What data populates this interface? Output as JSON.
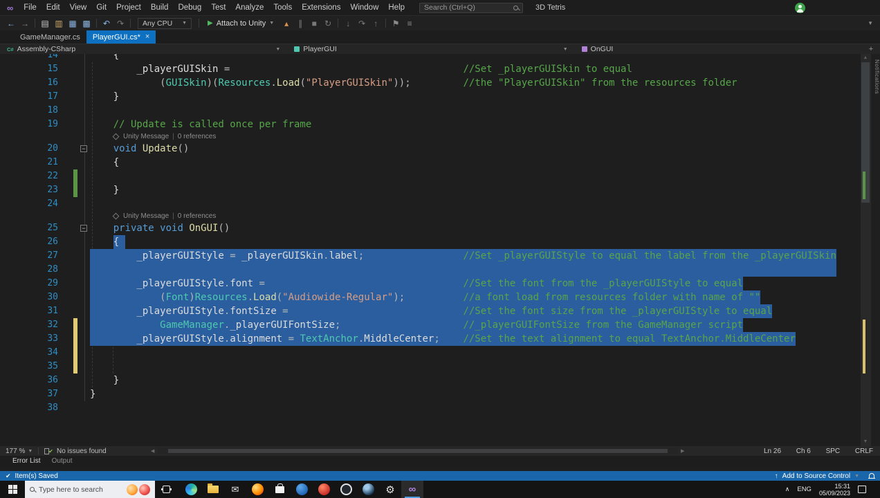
{
  "window": {
    "project": "3D Tetris",
    "search": "Search (Ctrl+Q)"
  },
  "menus": [
    "File",
    "Edit",
    "View",
    "Git",
    "Project",
    "Build",
    "Debug",
    "Test",
    "Analyze",
    "Tools",
    "Extensions",
    "Window",
    "Help"
  ],
  "toolbar": {
    "config_label": "Any CPU",
    "run_label": "Attach to Unity",
    "items_left": [
      {
        "n": "back-arrow",
        "g": "←",
        "c": "#8ab4e0"
      },
      {
        "n": "forward-arrow",
        "g": "→",
        "c": "#8a8a8a"
      },
      {
        "sep": true
      },
      {
        "n": "new-file-icon",
        "g": "▤",
        "c": "#c8c8c8"
      },
      {
        "n": "open-file-icon",
        "g": "▥",
        "c": "#c8a96a"
      },
      {
        "n": "save-icon",
        "g": "▦",
        "c": "#8ab4e0"
      },
      {
        "n": "save-all-icon",
        "g": "▩",
        "c": "#8ab4e0"
      },
      {
        "sep": true
      },
      {
        "n": "undo-icon",
        "g": "↶",
        "c": "#8ab4e0"
      },
      {
        "n": "redo-icon",
        "g": "↷",
        "c": "#7a7a7a"
      },
      {
        "sep": true
      }
    ],
    "items_right": [
      {
        "n": "hot-reload-icon",
        "g": "▴",
        "c": "#d9914f"
      },
      {
        "n": "pause-icon",
        "g": "∥",
        "c": "#7a7a7a"
      },
      {
        "n": "stop-icon",
        "g": "■",
        "c": "#7a7a7a"
      },
      {
        "n": "restart-icon",
        "g": "↻",
        "c": "#7a7a7a"
      },
      {
        "sep": true
      },
      {
        "n": "step-into-icon",
        "g": "↓",
        "c": "#7a7a7a"
      },
      {
        "n": "step-over-icon",
        "g": "↷",
        "c": "#7a7a7a"
      },
      {
        "n": "step-out-icon",
        "g": "↑",
        "c": "#7a7a7a"
      },
      {
        "sep": true
      },
      {
        "n": "bookmark-icon",
        "g": "⚑",
        "c": "#8a8a8a"
      },
      {
        "n": "outline-icon",
        "g": "≡",
        "c": "#8a8a8a"
      }
    ]
  },
  "tabs": [
    {
      "label": "GameManager.cs",
      "active": false
    },
    {
      "label": "PlayerGUI.cs*",
      "active": true
    }
  ],
  "breadcrumb": [
    "Assembly-CSharp",
    "PlayerGUI",
    "OnGUI"
  ],
  "side_strip": {
    "label": "Notifications"
  },
  "editor": {
    "rows": [
      {
        "n": 14,
        "tok": [
          [
            "p",
            "    {"
          ]
        ]
      },
      {
        "n": 15,
        "tok": [
          [
            "p",
            "        _playerGUISkin "
          ],
          [
            "o",
            "="
          ]
        ],
        "cmt": "//Set _playerGUISkin to equal"
      },
      {
        "n": 16,
        "tok": [
          [
            "o",
            "            ("
          ],
          [
            "t",
            "GUISkin"
          ],
          [
            "o",
            ")("
          ],
          [
            "t",
            "Resources"
          ],
          [
            "o",
            "."
          ],
          [
            "m",
            "Load"
          ],
          [
            "o",
            "("
          ],
          [
            "s",
            "\"PlayerGUISkin\""
          ],
          [
            "o",
            "));"
          ]
        ],
        "cmt": "//the \"PlayerGUISkin\" from the resources folder"
      },
      {
        "n": 17,
        "tok": [
          [
            "p",
            "    }"
          ]
        ]
      },
      {
        "n": 18
      },
      {
        "n": 19,
        "tok": [
          [
            "c",
            "    // Update is called once per frame"
          ]
        ]
      },
      {
        "lens": true,
        "a": "Unity Message",
        "b": "0 references"
      },
      {
        "n": 20,
        "fold": true,
        "tok": [
          [
            "k",
            "    void"
          ],
          [
            "p",
            " "
          ],
          [
            "m",
            "Update"
          ],
          [
            "o",
            "()"
          ]
        ]
      },
      {
        "n": 21,
        "tok": [
          [
            "p",
            "    {"
          ]
        ]
      },
      {
        "n": 22
      },
      {
        "n": 23,
        "tok": [
          [
            "p",
            "    }"
          ]
        ]
      },
      {
        "n": 24
      },
      {
        "lens": true,
        "a": "Unity Message",
        "b": "0 references"
      },
      {
        "n": 25,
        "fold": true,
        "tok": [
          [
            "k",
            "    private"
          ],
          [
            "p",
            " "
          ],
          [
            "k",
            "void"
          ],
          [
            "p",
            " "
          ],
          [
            "m",
            "OnGUI"
          ],
          [
            "o",
            "()"
          ]
        ]
      },
      {
        "n": 26,
        "sel": [
          4,
          2
        ],
        "tok": [
          [
            "p",
            "    {"
          ]
        ]
      },
      {
        "n": 27,
        "sel": [
          0,
          128
        ],
        "tok": [
          [
            "p",
            "        _playerGUIStyle "
          ],
          [
            "o",
            "= "
          ],
          [
            "p",
            "_playerGUISkin"
          ],
          [
            "o",
            "."
          ],
          [
            "p",
            "label"
          ],
          [
            "o",
            ";"
          ]
        ],
        "cmt": "//Set _playerGUIStyle to equal the label from the _playerGUISkin"
      },
      {
        "n": 28,
        "sel": [
          0,
          128
        ]
      },
      {
        "n": 29,
        "sel": [
          0,
          112
        ],
        "tok": [
          [
            "p",
            "        _playerGUIStyle"
          ],
          [
            "o",
            "."
          ],
          [
            "p",
            "font "
          ],
          [
            "o",
            "="
          ]
        ],
        "cmt": "//Set the font from the _playerGUIStyle to equal"
      },
      {
        "n": 30,
        "sel": [
          0,
          115
        ],
        "tok": [
          [
            "o",
            "            ("
          ],
          [
            "t",
            "Font"
          ],
          [
            "o",
            ")"
          ],
          [
            "t",
            "Resources"
          ],
          [
            "o",
            "."
          ],
          [
            "m",
            "Load"
          ],
          [
            "o",
            "("
          ],
          [
            "s",
            "\"Audiowide-Regular\""
          ],
          [
            "o",
            ");"
          ]
        ],
        "cmt": "//a font load from resources folder with name of \"\""
      },
      {
        "n": 31,
        "sel": [
          0,
          117
        ],
        "tok": [
          [
            "p",
            "        _playerGUIStyle"
          ],
          [
            "o",
            "."
          ],
          [
            "p",
            "fontSize "
          ],
          [
            "o",
            "="
          ]
        ],
        "cmt": "//Set the font size from the _playerGUIStyle to equal"
      },
      {
        "n": 32,
        "sel": [
          0,
          112
        ],
        "tok": [
          [
            "p",
            "            "
          ],
          [
            "t",
            "GameManager"
          ],
          [
            "o",
            "."
          ],
          [
            "p",
            "_playerGUIFontSize"
          ],
          [
            "o",
            ";"
          ]
        ],
        "cmt": "//_playerGUIFontSize from the GameManager script"
      },
      {
        "n": 33,
        "sel": [
          0,
          121
        ],
        "tok": [
          [
            "p",
            "        _playerGUIStyle"
          ],
          [
            "o",
            "."
          ],
          [
            "p",
            "alignment "
          ],
          [
            "o",
            "= "
          ],
          [
            "t",
            "TextAnchor"
          ],
          [
            "o",
            "."
          ],
          [
            "p",
            "MiddleCenter"
          ],
          [
            "o",
            ";"
          ]
        ],
        "cmt": "//Set the text alignment to equal TextAnchor.MiddleCenter"
      },
      {
        "n": 34
      },
      {
        "n": 35
      },
      {
        "n": 36,
        "tok": [
          [
            "p",
            "    }"
          ]
        ]
      },
      {
        "n": 37,
        "tok": [
          [
            "p",
            "}"
          ]
        ]
      },
      {
        "n": 38
      }
    ]
  },
  "editor_status": {
    "zoom": "177 %",
    "health": "No issues found",
    "ln": "Ln 26",
    "col": "Ch 6",
    "spc": "SPC",
    "eol": "CRLF"
  },
  "panel_tabs": [
    "Error List",
    "Output"
  ],
  "status_bar": {
    "saved": "Item(s) Saved",
    "source_control": "Add to Source Control"
  },
  "taskbar": {
    "search_placeholder": "Type here to search",
    "lang": "ENG",
    "time": "15:31",
    "date": "05/09/2023",
    "apps": [
      {
        "name": "edge"
      },
      {
        "name": "file-explorer"
      },
      {
        "name": "mail"
      },
      {
        "name": "firefox"
      },
      {
        "name": "store"
      },
      {
        "name": "app-blue"
      },
      {
        "name": "app-red"
      },
      {
        "name": "obs"
      },
      {
        "name": "steam"
      },
      {
        "name": "settings"
      },
      {
        "name": "visual-studio",
        "active": true
      }
    ]
  }
}
